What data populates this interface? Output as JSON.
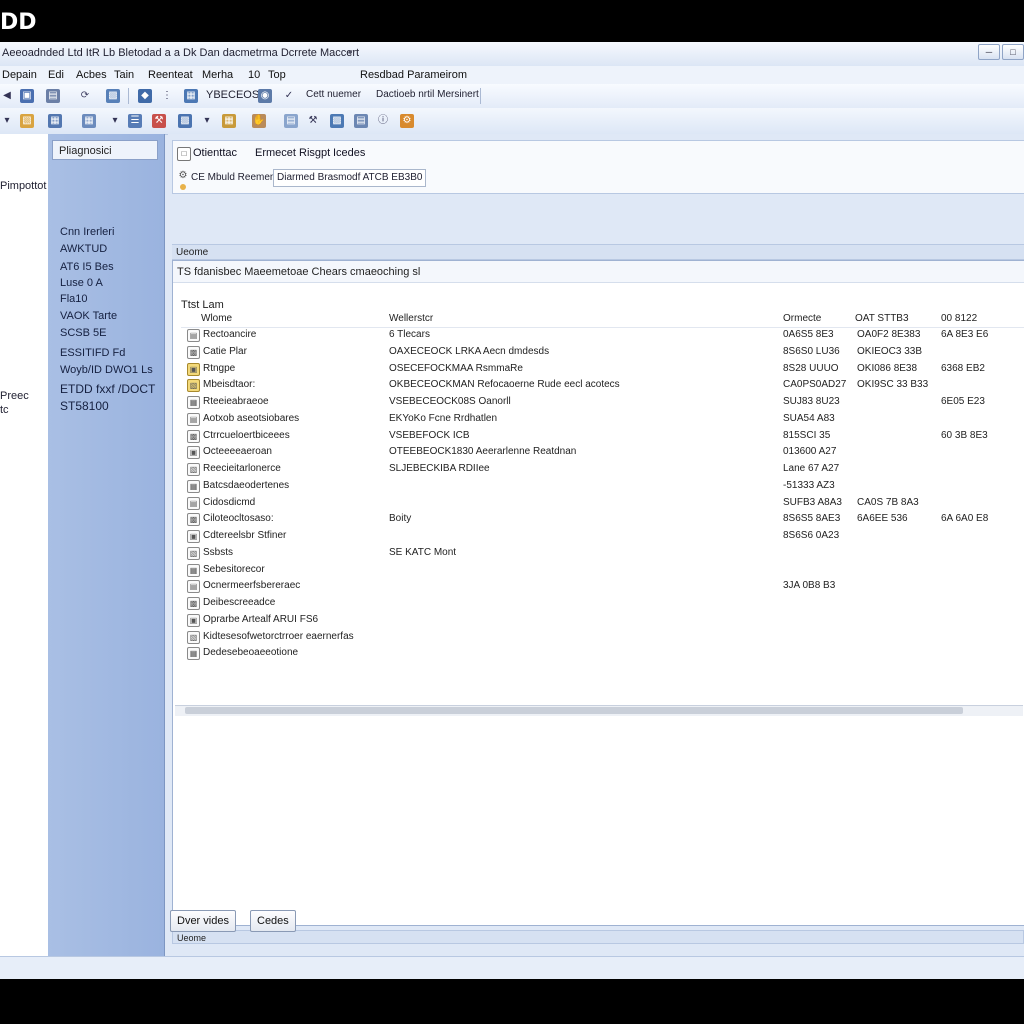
{
  "brand": "DD",
  "window": {
    "title": "Aeeoadnded Ltd ItR Lb Bletodad a a Dk Dan dacmetrma Dcrrete Maccert"
  },
  "menu": [
    "Depain",
    "Edi",
    "Acbes",
    "Tain",
    "Reenteat",
    "Merha",
    "10",
    "Top"
  ],
  "menu_extra": "Resdbad Parameirom",
  "toolbar1": {
    "field_text": "YBECEOS",
    "label1": "Cett nuemer",
    "label2": "Dactioeb nrtil Mersinert"
  },
  "left_pane": {
    "labels": [
      "Pimpottot",
      "Preec",
      "tc"
    ]
  },
  "nav_pane": {
    "header": "Pliagnosici",
    "items": [
      "Cnn Irerleri",
      "AWKTUD",
      "AT6 I5 Bes",
      "Luse 0 A",
      "Fla10",
      "VAOK Tarte",
      "SCSB 5E",
      "ESSITIFD Fd",
      "Woyb/ID DWO1 Ls",
      "ETDD fxxf /DOCT",
      "ST58100"
    ]
  },
  "tabs": [
    "Otienttac",
    "Ermecet Risgpt",
    "Icedes"
  ],
  "crumbs": [
    "CE Mbuld Reemen",
    "Diarmed Brasmodf ATCB EB3B0"
  ],
  "section_label": "Ueome",
  "info_line": "TS fdanisbec Maeemetoae Chears cmaeoching sl",
  "list_label": "Ttst Lam",
  "columns": [
    "Wlome",
    "Wellerstcr",
    "Ormecte",
    "OAT STTB3",
    "00 8122"
  ],
  "rows": [
    {
      "name": "Rectoancire",
      "desc": "6 Tlecars",
      "c1": "0A6S5 8E3",
      "c2": "OA0F2 8E383",
      "c3": "6A 8E3 E6"
    },
    {
      "name": "Catie Plar",
      "desc": "OAXECEOCK LRKA Aecn dmdesds",
      "c1": "8S6S0 LU36",
      "c2": "OKIEOC3 33B",
      "c3": ""
    },
    {
      "name": "Rtngpe",
      "desc": "OSECEFOCKMAA RsmmaRe",
      "c1": "8S28 UUUO",
      "c2": "OKI086 8E38",
      "c3": "6368 EB2"
    },
    {
      "name": "Mbeisdtaor:",
      "desc": "OKBECEOCKMAN Refocaoerne Rude eecl acotecs",
      "c1": "CA0PS0AD27",
      "c2": "OKI9SC 33 B33",
      "c3": ""
    },
    {
      "name": "Rteeieabraeoe",
      "desc": "VSEBECEOCK08S Oanorll",
      "c1": "SUJ83 8U23",
      "c2": "",
      "c3": "6E05 E23"
    },
    {
      "name": "Aotxob aseotsiobares",
      "desc": "EKYoKo Fcne Rrdhatlen",
      "c1": "SUA54 A83",
      "c2": "",
      "c3": ""
    },
    {
      "name": "Ctrrcueloertbiceees",
      "desc": "VSEBEFOCK ICB",
      "c1": "815SCI 35",
      "c2": "",
      "c3": "60 3B 8E3"
    },
    {
      "name": "Octeeeeaeroan",
      "desc": "OTEEBEOCK1830 Aeerarlenne Reatdnan",
      "c1": "013600 A27",
      "c2": "",
      "c3": ""
    },
    {
      "name": "Reecieitarlonerce",
      "desc": "SLJEBECKIBA RDIIee",
      "c1": "Lane 67 A27",
      "c2": "",
      "c3": ""
    },
    {
      "name": "Batcsdaeodertenes",
      "desc": "",
      "c1": "-51333 AZ3",
      "c2": "",
      "c3": ""
    },
    {
      "name": "Cidosdicmd",
      "desc": "",
      "c1": "SUFB3 A8A3",
      "c2": "CA0S 7B 8A3",
      "c3": ""
    },
    {
      "name": "Ciloteocltosaso:",
      "desc": "Boity",
      "c1": "8S6S5 8AE3",
      "c2": "6A6EE 536",
      "c3": "6A 6A0 E8"
    },
    {
      "name": "Cdtereelsbr Stfiner",
      "desc": "",
      "c1": "8S6S6 0A23",
      "c2": "",
      "c3": ""
    },
    {
      "name": "Ssbsts",
      "desc": "SE KATC Mont",
      "c1": "",
      "c2": "",
      "c3": ""
    },
    {
      "name": "Sebesitorecor",
      "desc": "",
      "c1": "",
      "c2": "",
      "c3": ""
    },
    {
      "name": "Ocnermeerfsbereraec",
      "desc": "",
      "c1": "3JA 0B8 B3",
      "c2": "",
      "c3": ""
    },
    {
      "name": "Deibescreeadce",
      "desc": "",
      "c1": "",
      "c2": "",
      "c3": ""
    },
    {
      "name": "Oprarbe Artealf ARUI FS6",
      "desc": "",
      "c1": "",
      "c2": "",
      "c3": ""
    },
    {
      "name": "Kidtesesofwetorctrroer eaernerfas",
      "desc": "",
      "c1": "",
      "c2": "",
      "c3": ""
    },
    {
      "name": "Dedesebeoaeeotione",
      "desc": "",
      "c1": "",
      "c2": "",
      "c3": ""
    }
  ],
  "bottom_label": "Ueome",
  "buttons": {
    "overvides": "Dver vides",
    "codes": "Cedes"
  }
}
